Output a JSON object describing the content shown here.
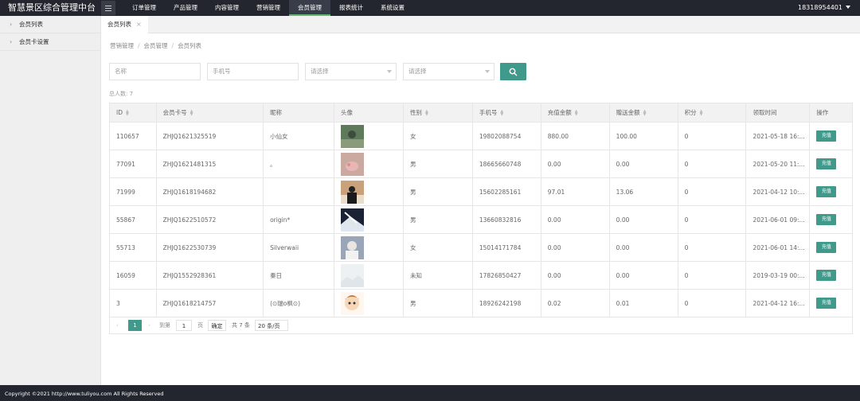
{
  "app": {
    "title": "智慧景区综合管理中台",
    "user": "18318954401"
  },
  "nav": [
    {
      "label": "订单管理"
    },
    {
      "label": "产品管理"
    },
    {
      "label": "内容管理"
    },
    {
      "label": "营销管理"
    },
    {
      "label": "会员管理"
    },
    {
      "label": "报表统计"
    },
    {
      "label": "系统设置"
    }
  ],
  "nav_active": "会员管理",
  "sidebar": {
    "items": [
      {
        "label": "会员列表"
      },
      {
        "label": "会员卡设置"
      }
    ]
  },
  "tab": {
    "label": "会员列表",
    "close": "×"
  },
  "breadcrumb": [
    "营销管理",
    "会员管理",
    "会员列表"
  ],
  "breadcrumb_sep": "/",
  "filters": {
    "name_placeholder": "名称",
    "phone_placeholder": "手机号",
    "select1": "请选择",
    "select2": "请选择"
  },
  "total": "总人数: 7",
  "table": {
    "headers": [
      "ID",
      "会员卡号",
      "昵称",
      "头像",
      "性别",
      "手机号",
      "充值金额",
      "赠送金额",
      "积分",
      "领取时间",
      "操作"
    ],
    "action_label": "充值",
    "rows": [
      {
        "id": "110657",
        "card": "ZHJQ1621325519",
        "nick": "小仙女",
        "avatar": "avatar-1",
        "gender": "女",
        "phone": "19802088754",
        "recharge": "880.00",
        "gift": "100.00",
        "points": "0",
        "time": "2021-05-18 16:..."
      },
      {
        "id": "77091",
        "card": "ZHJQ1621481315",
        "nick": "。",
        "avatar": "avatar-2",
        "gender": "男",
        "phone": "18665660748",
        "recharge": "0.00",
        "gift": "0.00",
        "points": "0",
        "time": "2021-05-20 11:..."
      },
      {
        "id": "71999",
        "card": "ZHJQ1618194682",
        "nick": "",
        "avatar": "avatar-3",
        "gender": "男",
        "phone": "15602285161",
        "recharge": "97.01",
        "gift": "13.06",
        "points": "0",
        "time": "2021-04-12 10:..."
      },
      {
        "id": "55867",
        "card": "ZHJQ1622510572",
        "nick": "origin*",
        "avatar": "avatar-4",
        "gender": "男",
        "phone": "13660832816",
        "recharge": "0.00",
        "gift": "0.00",
        "points": "0",
        "time": "2021-06-01 09:..."
      },
      {
        "id": "55713",
        "card": "ZHJQ1622530739",
        "nick": "Silverwaii",
        "avatar": "avatar-5",
        "gender": "女",
        "phone": "15014171784",
        "recharge": "0.00",
        "gift": "0.00",
        "points": "0",
        "time": "2021-06-01 14:..."
      },
      {
        "id": "16059",
        "card": "ZHJQ1552928361",
        "nick": "秦日",
        "avatar": "avatar-6",
        "gender": "未知",
        "phone": "17826850427",
        "recharge": "0.00",
        "gift": "0.00",
        "points": "0",
        "time": "2019-03-19 00:..."
      },
      {
        "id": "3",
        "card": "ZHJQ1618214757",
        "nick": "(⊙瑞o枫⊙)",
        "avatar": "avatar-7",
        "gender": "男",
        "phone": "18926242198",
        "recharge": "0.02",
        "gift": "0.01",
        "points": "0",
        "time": "2021-04-12 16:..."
      }
    ]
  },
  "pager": {
    "prev": "‹",
    "current": "1",
    "next": "›",
    "goto": "到第",
    "input": "1",
    "page": "页",
    "confirm": "确定",
    "total": "共 7 条",
    "size": "20 条/页"
  },
  "footer": "Copyright ©2021 http://www.tuliyou.com All Rights Reserved",
  "colors": {
    "accent": "#3f9a8c",
    "topbar": "#23262e",
    "nav_active_line": "#5fb878"
  }
}
